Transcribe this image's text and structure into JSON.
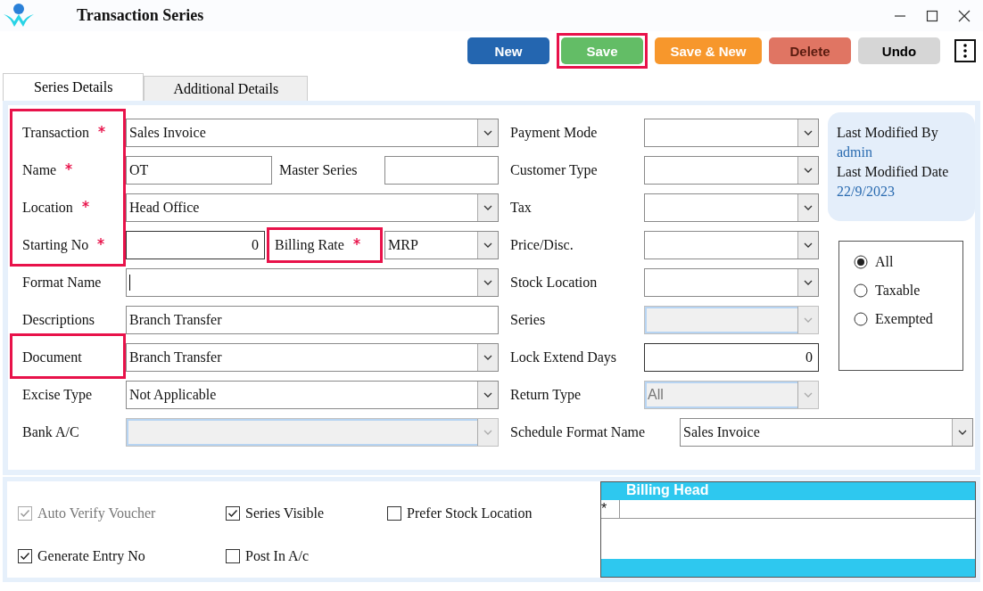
{
  "window": {
    "title": "Transaction Series"
  },
  "toolbar": [
    {
      "label": "New",
      "kind": "new",
      "highlighted": false
    },
    {
      "label": "Save",
      "kind": "save",
      "highlighted": true
    },
    {
      "label": "Save & New",
      "kind": "save_new",
      "highlighted": false
    },
    {
      "label": "Delete",
      "kind": "delete",
      "highlighted": false
    },
    {
      "label": "Undo",
      "kind": "undo",
      "highlighted": false
    }
  ],
  "tabs": [
    {
      "label": "Series Details",
      "selected": true
    },
    {
      "label": "Additional Details",
      "selected": false
    }
  ],
  "fields": [
    {
      "label": "Transaction",
      "required": true,
      "highlighted": true,
      "control": {
        "kind": "dropdown",
        "value": "Sales Invoice"
      }
    },
    {
      "label": "Name",
      "required": true,
      "highlighted": true,
      "control": {
        "kind": "input",
        "value": "OT"
      },
      "side": {
        "label": "Master Series",
        "required": false,
        "highlighted": false,
        "control": {
          "kind": "input"
        }
      }
    },
    {
      "label": "Location",
      "required": true,
      "highlighted": true,
      "control": {
        "kind": "dropdown",
        "value": "Head Office"
      }
    },
    {
      "label": "Starting No",
      "required": true,
      "highlighted": true,
      "control": {
        "kind": "number",
        "value": "0"
      },
      "side": {
        "label": "Billing Rate",
        "required": true,
        "highlighted": true,
        "control": {
          "kind": "dropdown",
          "value": "MRP"
        }
      }
    },
    {
      "label": "Format Name",
      "required": false,
      "highlighted": false,
      "control": {
        "kind": "dropdown",
        "focused": true
      }
    },
    {
      "label": "Descriptions",
      "required": false,
      "highlighted": false,
      "control": {
        "kind": "input",
        "value": "Branch Transfer"
      }
    },
    {
      "label": "Document",
      "required": false,
      "highlighted": true,
      "control": {
        "kind": "dropdown",
        "value": "Branch Transfer"
      }
    },
    {
      "label": "Excise Type",
      "required": false,
      "highlighted": false,
      "control": {
        "kind": "dropdown",
        "value": "Not Applicable"
      }
    },
    {
      "label": "Bank A/C",
      "required": false,
      "highlighted": false,
      "control": {
        "kind": "disabled_dropdown"
      }
    }
  ],
  "middle_fields": [
    {
      "label": "Payment Mode",
      "control": {
        "kind": "dropdown"
      }
    },
    {
      "label": "Customer Type",
      "control": {
        "kind": "dropdown"
      }
    },
    {
      "label": "Tax",
      "control": {
        "kind": "dropdown"
      }
    },
    {
      "label": "Price/Disc.",
      "control": {
        "kind": "dropdown"
      }
    },
    {
      "label": "Stock Location",
      "control": {
        "kind": "dropdown"
      }
    },
    {
      "label": "Series",
      "control": {
        "kind": "disabled_dropdown"
      }
    },
    {
      "label": "Lock Extend Days",
      "control": {
        "kind": "number",
        "value": "0"
      }
    },
    {
      "label": "Return Type",
      "control": {
        "kind": "disabled_dropdown",
        "value": "All"
      }
    },
    {
      "label": "Schedule Format Name",
      "wide": true,
      "control": {
        "kind": "dropdown",
        "value": "Sales Invoice"
      }
    }
  ],
  "last_modified": {
    "by_label": "Last Modified By",
    "by": "admin",
    "date_label": "Last Modified Date",
    "date": "22/9/2023"
  },
  "tax_filter": [
    {
      "label": "All",
      "selected": true
    },
    {
      "label": "Taxable",
      "selected": false
    },
    {
      "label": "Exempted",
      "selected": false
    }
  ],
  "options": [
    {
      "label": "Auto Verify Voucher",
      "checked": true,
      "disabled": true
    },
    {
      "label": "Series Visible",
      "checked": true,
      "disabled": false
    },
    {
      "label": "Prefer Stock Location",
      "checked": false,
      "disabled": false
    },
    {
      "label": "Generate Entry No",
      "checked": true,
      "disabled": false
    },
    {
      "label": "Post In A/c",
      "checked": false,
      "disabled": false
    }
  ],
  "billing_head": {
    "title": "Billing Head",
    "new_row_marker": "*"
  }
}
